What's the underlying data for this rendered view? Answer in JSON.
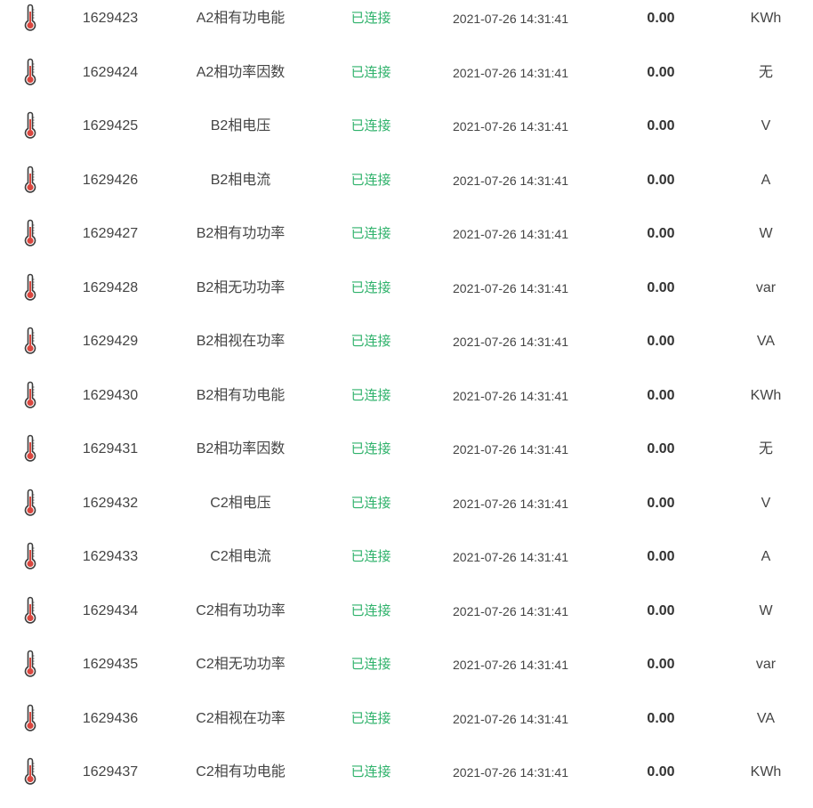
{
  "colors": {
    "status_connected": "#2fb26b",
    "thermometer_fill": "#d9473f",
    "thermometer_outline": "#3b3b3b"
  },
  "row_icon": "thermometer-icon",
  "rows": [
    {
      "id": "1629423",
      "name": "A2相有功电能",
      "status": "已连接",
      "time": "2021-07-26 14:31:41",
      "value": "0.00",
      "unit": "KWh"
    },
    {
      "id": "1629424",
      "name": "A2相功率因数",
      "status": "已连接",
      "time": "2021-07-26 14:31:41",
      "value": "0.00",
      "unit": "无"
    },
    {
      "id": "1629425",
      "name": "B2相电压",
      "status": "已连接",
      "time": "2021-07-26 14:31:41",
      "value": "0.00",
      "unit": "V"
    },
    {
      "id": "1629426",
      "name": "B2相电流",
      "status": "已连接",
      "time": "2021-07-26 14:31:41",
      "value": "0.00",
      "unit": "A"
    },
    {
      "id": "1629427",
      "name": "B2相有功功率",
      "status": "已连接",
      "time": "2021-07-26 14:31:41",
      "value": "0.00",
      "unit": "W"
    },
    {
      "id": "1629428",
      "name": "B2相无功功率",
      "status": "已连接",
      "time": "2021-07-26 14:31:41",
      "value": "0.00",
      "unit": "var"
    },
    {
      "id": "1629429",
      "name": "B2相视在功率",
      "status": "已连接",
      "time": "2021-07-26 14:31:41",
      "value": "0.00",
      "unit": "VA"
    },
    {
      "id": "1629430",
      "name": "B2相有功电能",
      "status": "已连接",
      "time": "2021-07-26 14:31:41",
      "value": "0.00",
      "unit": "KWh"
    },
    {
      "id": "1629431",
      "name": "B2相功率因数",
      "status": "已连接",
      "time": "2021-07-26 14:31:41",
      "value": "0.00",
      "unit": "无"
    },
    {
      "id": "1629432",
      "name": "C2相电压",
      "status": "已连接",
      "time": "2021-07-26 14:31:41",
      "value": "0.00",
      "unit": "V"
    },
    {
      "id": "1629433",
      "name": "C2相电流",
      "status": "已连接",
      "time": "2021-07-26 14:31:41",
      "value": "0.00",
      "unit": "A"
    },
    {
      "id": "1629434",
      "name": "C2相有功功率",
      "status": "已连接",
      "time": "2021-07-26 14:31:41",
      "value": "0.00",
      "unit": "W"
    },
    {
      "id": "1629435",
      "name": "C2相无功功率",
      "status": "已连接",
      "time": "2021-07-26 14:31:41",
      "value": "0.00",
      "unit": "var"
    },
    {
      "id": "1629436",
      "name": "C2相视在功率",
      "status": "已连接",
      "time": "2021-07-26 14:31:41",
      "value": "0.00",
      "unit": "VA"
    },
    {
      "id": "1629437",
      "name": "C2相有功电能",
      "status": "已连接",
      "time": "2021-07-26 14:31:41",
      "value": "0.00",
      "unit": "KWh"
    }
  ]
}
